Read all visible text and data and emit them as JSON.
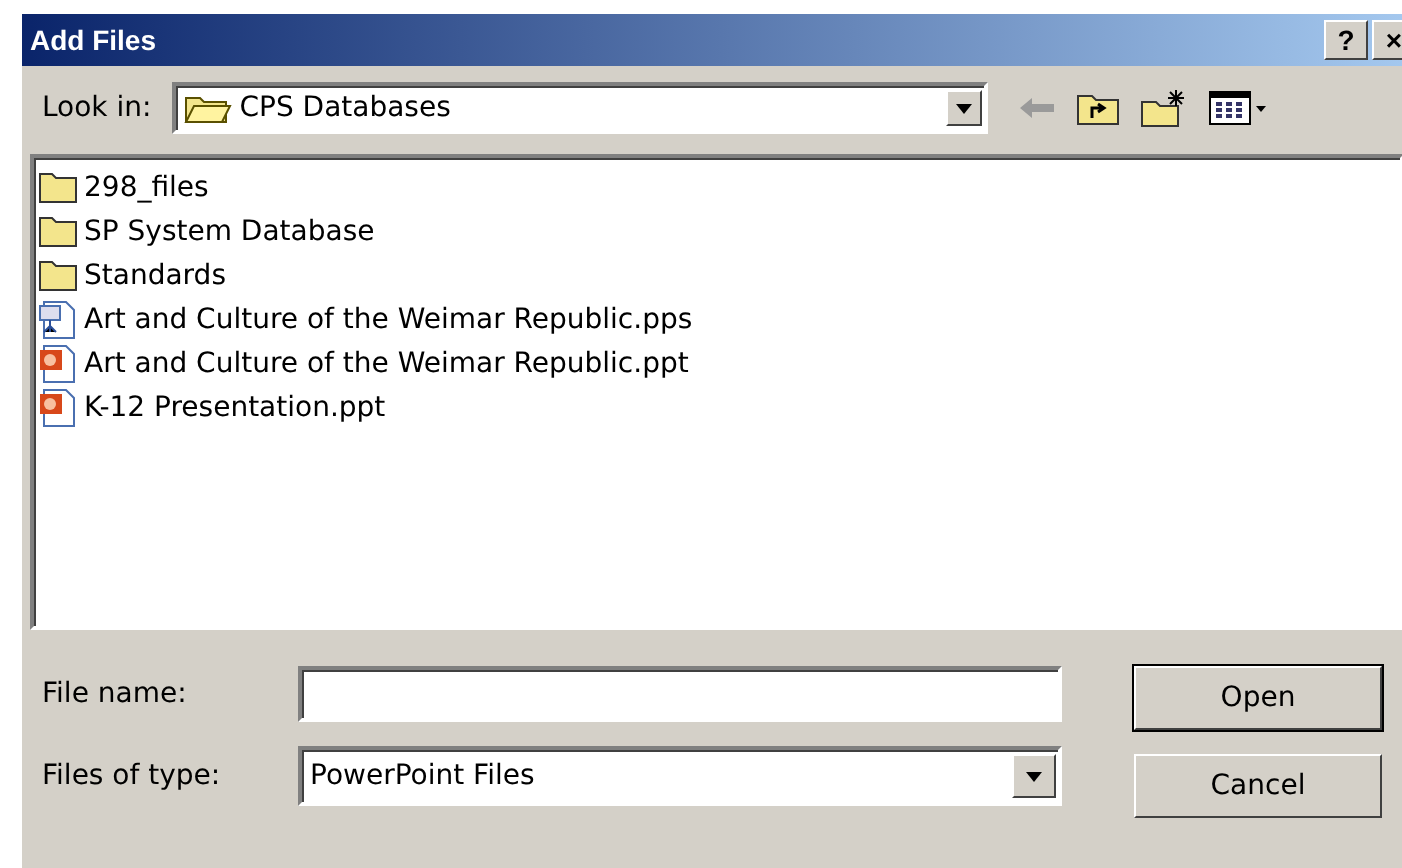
{
  "window": {
    "title": "Add Files",
    "help_button": "?",
    "close_button": "×"
  },
  "look_in": {
    "label": "Look in:",
    "value": "CPS Databases"
  },
  "files": [
    {
      "name": "298_files",
      "kind": "folder"
    },
    {
      "name": "SP System Database",
      "kind": "folder"
    },
    {
      "name": "Standards",
      "kind": "folder"
    },
    {
      "name": "Art and Culture of the Weimar Republic.pps",
      "kind": "pps"
    },
    {
      "name": "Art and Culture of the Weimar Republic.ppt",
      "kind": "ppt"
    },
    {
      "name": "K-12 Presentation.ppt",
      "kind": "ppt"
    }
  ],
  "file_name": {
    "label": "File name:"
  },
  "file_type": {
    "label": "Files of type:",
    "value": "PowerPoint Files"
  },
  "buttons": [
    {
      "label": "Open",
      "default": true
    },
    {
      "label": "Cancel",
      "default": false
    }
  ]
}
